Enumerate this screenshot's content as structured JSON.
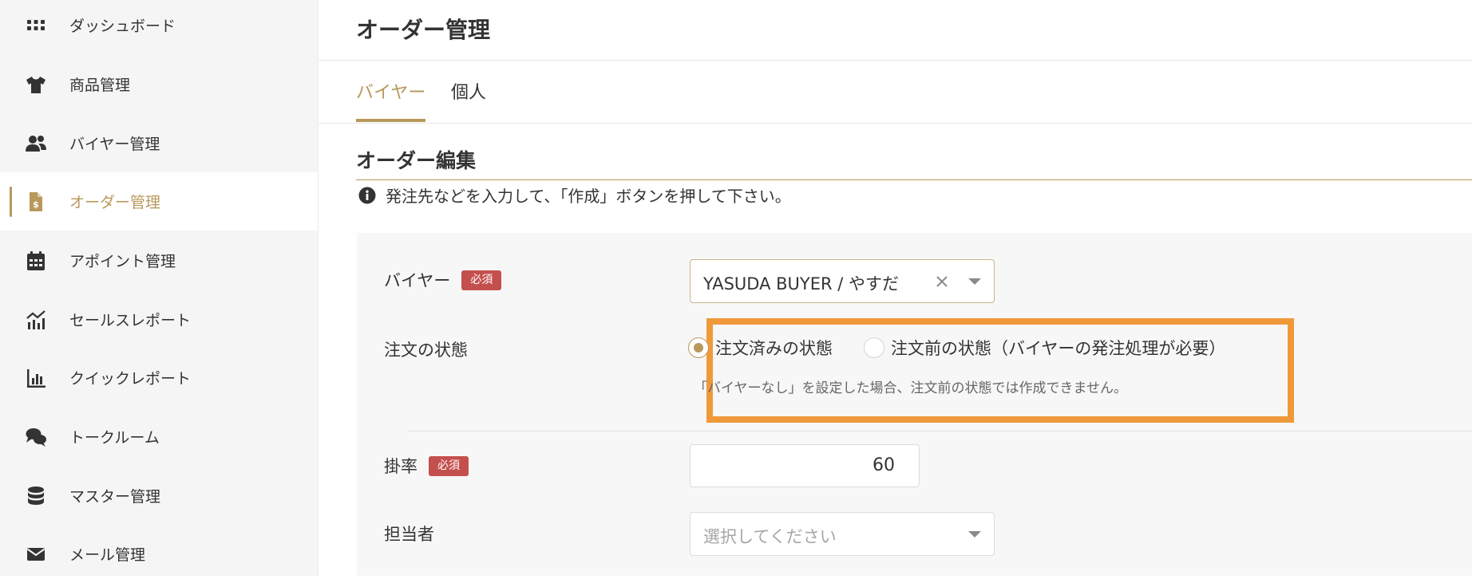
{
  "sidebar": {
    "items": [
      {
        "label": "ダッシュボード",
        "icon": "grid-icon"
      },
      {
        "label": "商品管理",
        "icon": "tshirt-icon"
      },
      {
        "label": "バイヤー管理",
        "icon": "users-icon"
      },
      {
        "label": "オーダー管理",
        "icon": "invoice-icon",
        "active": true
      },
      {
        "label": "アポイント管理",
        "icon": "calendar-icon"
      },
      {
        "label": "セールスレポート",
        "icon": "chart-line-icon"
      },
      {
        "label": "クイックレポート",
        "icon": "chart-bar-icon"
      },
      {
        "label": "トークルーム",
        "icon": "comments-icon"
      },
      {
        "label": "マスター管理",
        "icon": "database-icon"
      },
      {
        "label": "メール管理",
        "icon": "envelope-icon"
      }
    ]
  },
  "header": {
    "title": "オーダー管理"
  },
  "tabs": [
    {
      "label": "バイヤー",
      "active": true
    },
    {
      "label": "個人",
      "active": false
    }
  ],
  "section": {
    "title": "オーダー編集",
    "info": "発注先などを入力して、「作成」ボタンを押して下さい。"
  },
  "form": {
    "buyer": {
      "label": "バイヤー",
      "required_badge": "必須",
      "value": "YASUDA BUYER / やすだ"
    },
    "order_status": {
      "label": "注文の状態",
      "options": [
        {
          "label": "注文済みの状態",
          "checked": true
        },
        {
          "label": "注文前の状態（バイヤーの発注処理が必要）",
          "checked": false
        }
      ],
      "hint": "「バイヤーなし」を設定した場合、注文前の状態では作成できません。"
    },
    "rate": {
      "label": "掛率",
      "required_badge": "必須",
      "value": "60"
    },
    "staff": {
      "label": "担当者",
      "placeholder": "選択してください"
    }
  },
  "colors": {
    "accent": "#b7995c",
    "required": "#c4504e",
    "highlight": "#f0993a"
  }
}
